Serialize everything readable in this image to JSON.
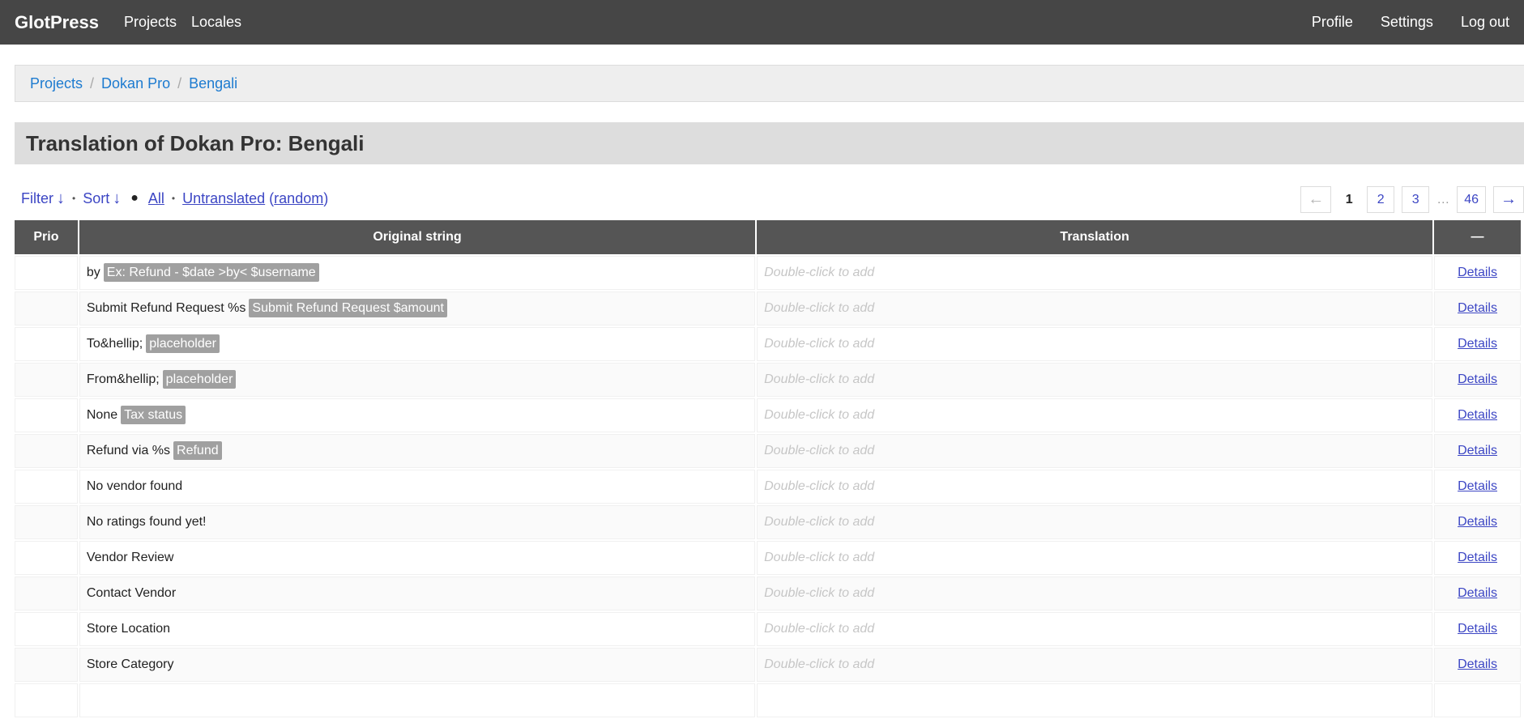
{
  "header": {
    "brand": "GlotPress",
    "nav": [
      {
        "label": "Projects"
      },
      {
        "label": "Locales"
      }
    ],
    "user_nav": [
      {
        "label": "Profile"
      },
      {
        "label": "Settings"
      },
      {
        "label": "Log out"
      }
    ]
  },
  "breadcrumb": [
    {
      "label": "Projects"
    },
    {
      "label": "Dokan Pro"
    },
    {
      "label": "Bengali"
    }
  ],
  "breadcrumb_sep": "/",
  "page_title": "Translation of Dokan Pro: Bengali",
  "filters": {
    "filter_label": "Filter",
    "sort_label": "Sort",
    "down_arrow": "↓",
    "dot": "•",
    "bullet": "●",
    "all_label": "All",
    "untranslated_label": "Untranslated",
    "paren_open": "(",
    "random_label": "random",
    "paren_close": ")"
  },
  "paging": {
    "prev": "←",
    "current": "1",
    "pages": [
      "2",
      "3"
    ],
    "dots": "…",
    "last": "46",
    "next": "→"
  },
  "table": {
    "columns": {
      "prio": "Prio",
      "original": "Original string",
      "translation": "Translation",
      "actions": "—"
    },
    "placeholder": "Double-click to add",
    "details_label": "Details",
    "rows": [
      {
        "prio": "",
        "original": "by",
        "context": "Ex: Refund - $date >by< $username"
      },
      {
        "prio": "",
        "original": "Submit Refund Request %s",
        "context": "Submit Refund Request $amount"
      },
      {
        "prio": "",
        "original": "To&hellip;",
        "context": "placeholder"
      },
      {
        "prio": "",
        "original": "From&hellip;",
        "context": "placeholder"
      },
      {
        "prio": "",
        "original": "None",
        "context": "Tax status"
      },
      {
        "prio": "",
        "original": "Refund via %s",
        "context": "Refund"
      },
      {
        "prio": "",
        "original": "No vendor found",
        "context": ""
      },
      {
        "prio": "",
        "original": "No ratings found yet!",
        "context": ""
      },
      {
        "prio": "",
        "original": "Vendor Review",
        "context": ""
      },
      {
        "prio": "",
        "original": "Contact Vendor",
        "context": ""
      },
      {
        "prio": "",
        "original": "Store Location",
        "context": ""
      },
      {
        "prio": "",
        "original": "Store Category",
        "context": ""
      },
      {
        "prio": "",
        "original": "",
        "context": ""
      }
    ]
  }
}
